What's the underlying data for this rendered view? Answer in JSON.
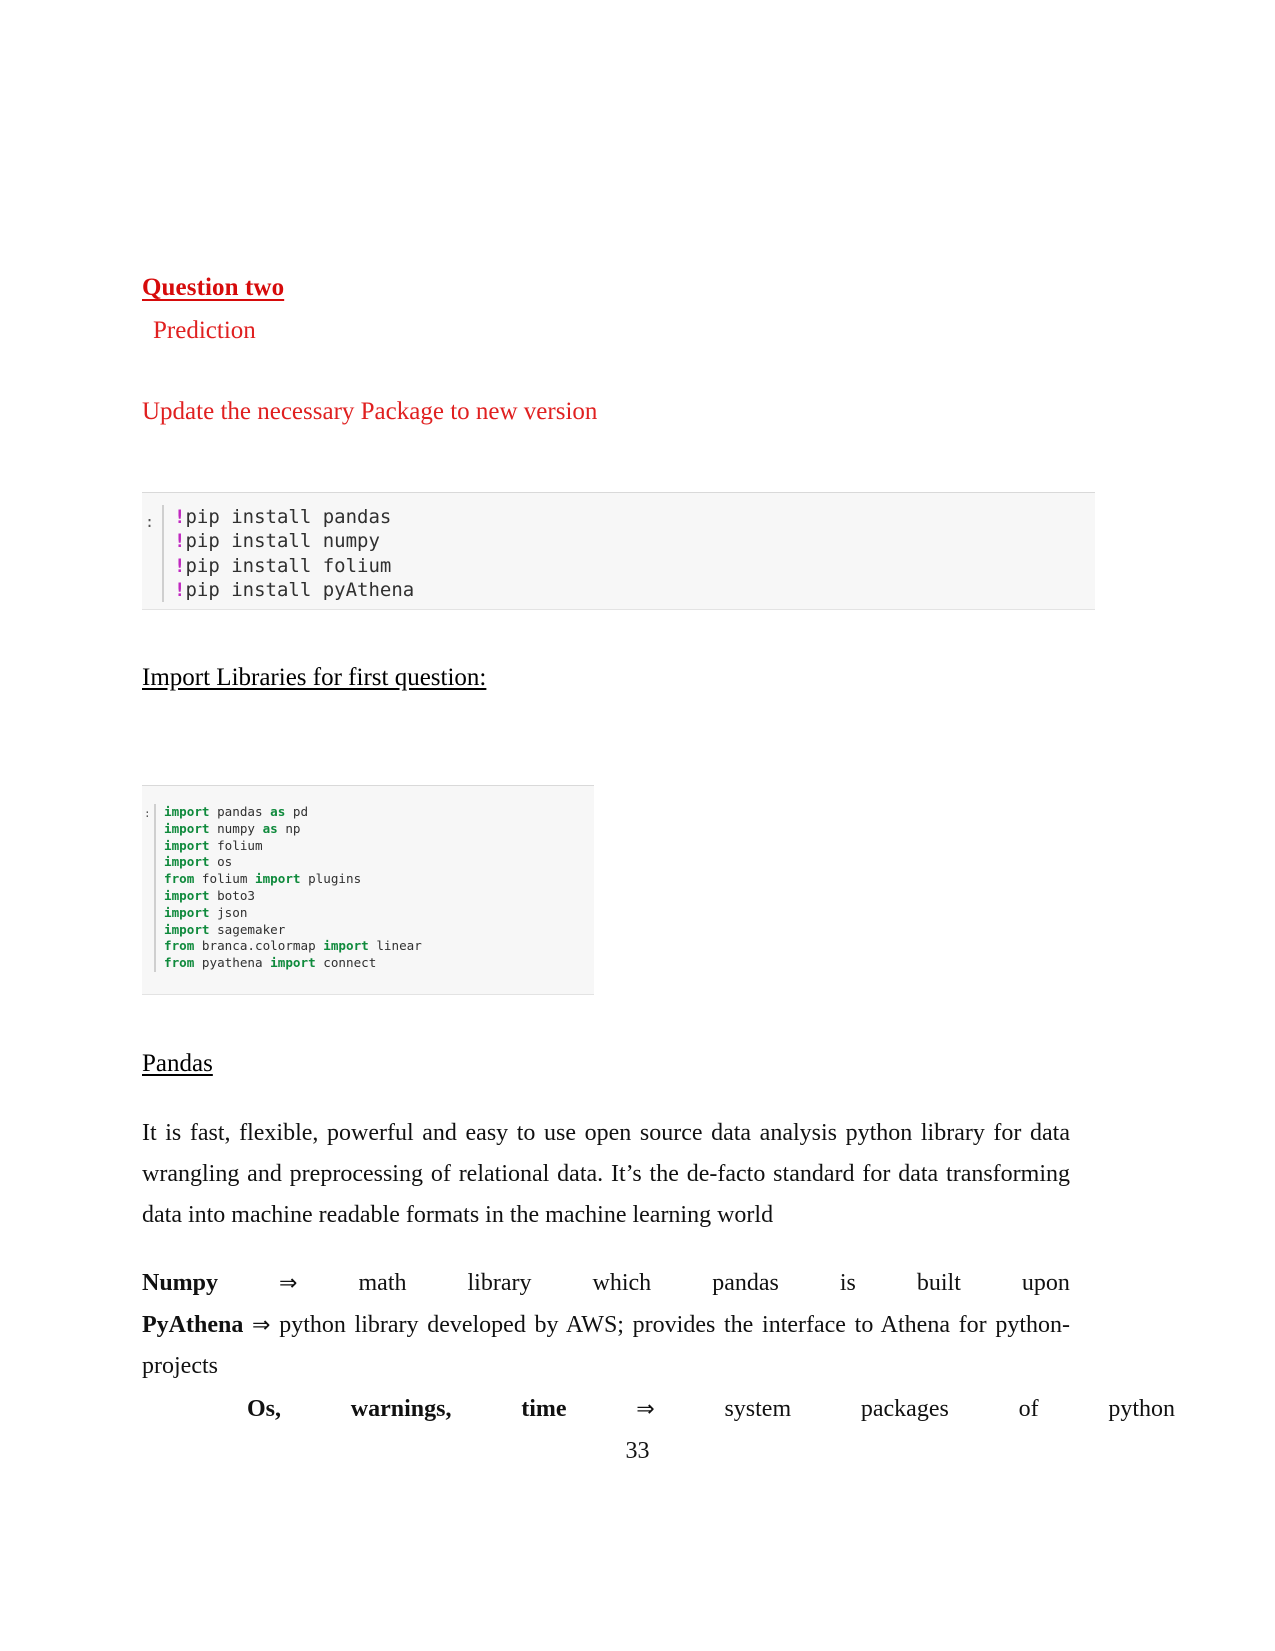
{
  "document": {
    "page_number": "33",
    "colors": {
      "heading_red": "#d60b0b",
      "text_red": "#e02020",
      "code_keyword_green": "#0f8a3c",
      "code_bang_magenta": "#c028c0",
      "code_background": "#f7f7f7",
      "body_text": "#111111"
    }
  },
  "headings": {
    "question": "Question two ",
    "prediction": "Prediction",
    "update_note": "Update the necessary Package to new  version",
    "import_libraries": "Import Libraries for first question:",
    "pandas": "Pandas"
  },
  "code_cell_one": {
    "prompt": ":",
    "lines": [
      {
        "bang": "!",
        "text": "pip install pandas"
      },
      {
        "bang": "!",
        "text": "pip install numpy"
      },
      {
        "bang": "!",
        "text": "pip install folium"
      },
      {
        "bang": "!",
        "text": "pip install pyAthena"
      }
    ]
  },
  "code_cell_two": {
    "prompt": ":",
    "lines": [
      {
        "kw1": "import",
        "mid": " pandas ",
        "kw2": "as",
        "rest": " pd"
      },
      {
        "kw1": "import",
        "mid": " numpy ",
        "kw2": "as",
        "rest": " np"
      },
      {
        "kw1": "import",
        "mid": " folium",
        "kw2": "",
        "rest": ""
      },
      {
        "kw1": "import",
        "mid": " os",
        "kw2": "",
        "rest": ""
      },
      {
        "kw1": "from",
        "mid": " folium ",
        "kw2": "import",
        "rest": " plugins"
      },
      {
        "kw1": "import",
        "mid": " boto3",
        "kw2": "",
        "rest": ""
      },
      {
        "kw1": "import",
        "mid": " json",
        "kw2": "",
        "rest": ""
      },
      {
        "kw1": "import",
        "mid": " sagemaker",
        "kw2": "",
        "rest": ""
      },
      {
        "kw1": "from",
        "mid": " branca.colormap ",
        "kw2": "import",
        "rest": " linear"
      },
      {
        "kw1": "from",
        "mid": " pyathena ",
        "kw2": "import",
        "rest": " connect"
      }
    ]
  },
  "body": {
    "pandas_paragraph": "It is fast, flexible, powerful and easy to use open source data analysis python library for data wrangling and preprocessing of relational data. It’s the de-facto standard for data transforming data into machine readable formats in the machine learning world",
    "numpy_def": {
      "term": "Numpy",
      "arrow": "⇒",
      "words": [
        "math",
        "library",
        "which",
        "pandas",
        "is",
        "built",
        "upon"
      ]
    },
    "pyathena_def": {
      "term": "PyAthena",
      "arrow": "⇒",
      "text": "python library developed by AWS; provides the interface to Athena for python-projects"
    },
    "os_def": {
      "term_parts": [
        "Os,",
        "warnings,",
        "time"
      ],
      "arrow": "⇒",
      "words": [
        "system",
        "packages",
        "of",
        "python"
      ]
    }
  }
}
